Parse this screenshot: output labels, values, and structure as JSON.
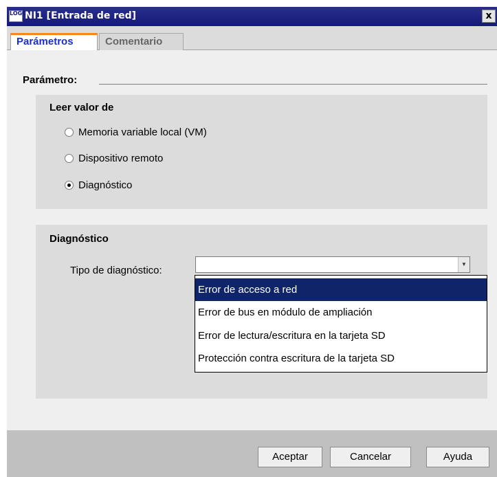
{
  "window": {
    "title": "NI1 [Entrada de red]",
    "icon_text": "LOGO!",
    "close_label": "x"
  },
  "tabs": [
    {
      "label": "Parámetros",
      "active": true
    },
    {
      "label": "Comentario",
      "active": false
    }
  ],
  "parameter_section": {
    "label": "Parámetro:"
  },
  "read_group": {
    "title": "Leer valor de",
    "options": [
      {
        "label": "Memoria variable local (VM)",
        "selected": false
      },
      {
        "label": "Dispositivo remoto",
        "selected": false
      },
      {
        "label": "Diagnóstico",
        "selected": true
      }
    ]
  },
  "diagnostic_group": {
    "title": "Diagnóstico",
    "type_label": "Tipo de diagnóstico:",
    "type_value": "",
    "dropdown_options": [
      {
        "label": "Error de acceso a red",
        "highlighted": true
      },
      {
        "label": "Error de bus en módulo de ampliación",
        "highlighted": false
      },
      {
        "label": "Error de lectura/escritura en la tarjeta SD",
        "highlighted": false
      },
      {
        "label": "Protección contra escritura de la tarjeta SD",
        "highlighted": false
      }
    ]
  },
  "buttons": {
    "ok": "Aceptar",
    "cancel": "Cancelar",
    "help": "Ayuda"
  },
  "colors": {
    "titlebar": "#14197a",
    "active_tab_text": "#1a2fd0",
    "active_tab_accent": "#f08a1c",
    "selection": "#102569"
  }
}
